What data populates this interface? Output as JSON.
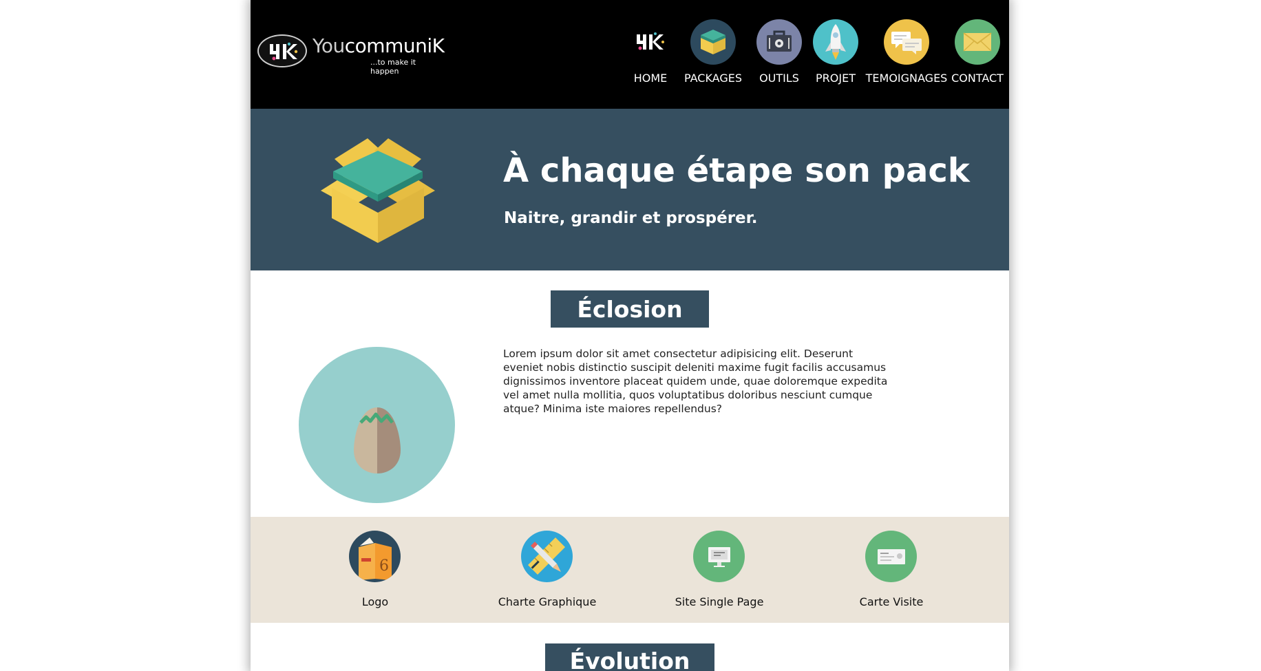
{
  "header": {
    "brand_part1": "You",
    "brand_part2": "communiK",
    "tagline": "...to make it happen",
    "nav": [
      {
        "label": "HOME",
        "icon": "yk-logo-icon",
        "color": "#3a3a3a"
      },
      {
        "label": "PACKAGES",
        "icon": "box-icon",
        "color": "#2d4a5e"
      },
      {
        "label": "OUTILS",
        "icon": "toolbox-icon",
        "color": "#7c84a8"
      },
      {
        "label": "PROJET",
        "icon": "rocket-icon",
        "color": "#4fc1c9"
      },
      {
        "label": "TEMOIGNAGES",
        "icon": "chat-bubbles-icon",
        "color": "#efc24a"
      },
      {
        "label": "CONTACT",
        "icon": "envelope-icon",
        "color": "#63b67a"
      }
    ]
  },
  "hero": {
    "title": "À chaque étape son pack",
    "subtitle": "Naitre, grandir et prospérer.",
    "color": "#364f60"
  },
  "eclosion": {
    "title": "Éclosion",
    "text": "Lorem ipsum dolor sit amet consectetur adipisicing elit. Deserunt eveniet nobis distinctio suscipit deleniti maxime fugit facilis accusamus dignissimos inventore placeat quidem unde, quae doloremque expedita vel amet nulla mollitia, quos voluptatibus doloribus nesciunt cumque atque? Minima iste maiores repellendus?",
    "icon": "hatching-egg-icon"
  },
  "features": [
    {
      "label": "Logo",
      "icon": "book-icon",
      "color": "#2d4a5e"
    },
    {
      "label": "Charte Graphique",
      "icon": "ruler-pencil-icon",
      "color": "#2fa6d8"
    },
    {
      "label": "Site Single Page",
      "icon": "monitor-icon",
      "color": "#63b67a"
    },
    {
      "label": "Carte Visite",
      "icon": "business-card-icon",
      "color": "#63b67a"
    }
  ],
  "evolution": {
    "title": "Évolution"
  }
}
